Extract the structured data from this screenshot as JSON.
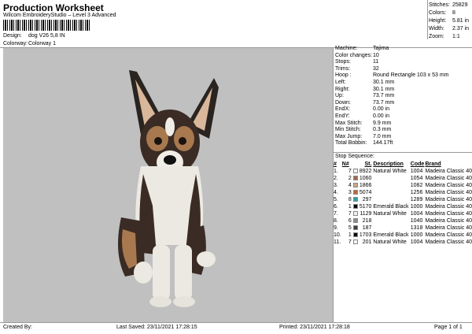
{
  "header": {
    "title": "Production Worksheet",
    "subtitle": "Wilcom EmbroideryStudio – Level 3 Advanced",
    "design_label": "Design:",
    "design_value": "dog V26 5,8 IN",
    "colorway_label": "Colorway:",
    "colorway_value": "Colorway 1"
  },
  "stats": [
    {
      "label": "Stitches:",
      "value": "25829"
    },
    {
      "label": "Colors:",
      "value": "8"
    },
    {
      "label": "Height:",
      "value": "5.81 in"
    },
    {
      "label": "Width:",
      "value": "2.37 in"
    },
    {
      "label": "Zoom:",
      "value": "1:1"
    }
  ],
  "machine": [
    {
      "label": "Machine:",
      "value": "Tajima"
    },
    {
      "label": "Color changes:",
      "value": "10"
    },
    {
      "label": "Stops:",
      "value": "11"
    },
    {
      "label": "Trims:",
      "value": "32"
    },
    {
      "label": "Hoop :",
      "value": "Round Rectangle 103 x 53 mm"
    },
    {
      "label": "Left:",
      "value": "30.1 mm"
    },
    {
      "label": "Right:",
      "value": "30.1 mm"
    },
    {
      "label": "Up:",
      "value": "73.7 mm"
    },
    {
      "label": "Down:",
      "value": "73.7 mm"
    },
    {
      "label": "EndX:",
      "value": "0.00 in"
    },
    {
      "label": "EndY:",
      "value": "0.00 in"
    },
    {
      "label": "Max Stitch:",
      "value": "9.9 mm"
    },
    {
      "label": "Min Stitch:",
      "value": "0.3 mm"
    },
    {
      "label": "Max Jump:",
      "value": "7.0 mm"
    },
    {
      "label": "Total Bobbin:",
      "value": "144.17ft"
    }
  ],
  "sequence": {
    "title": "Stop Sequence:",
    "headers": [
      "#",
      "N#",
      "St.",
      "Description",
      "Code",
      "Brand"
    ],
    "rows": [
      {
        "num": "1.",
        "n": "7",
        "color": "#f4f4f4",
        "st": "8922",
        "desc": "Natural White",
        "code": "1004",
        "brand": "Madeira Classic 40"
      },
      {
        "num": "2.",
        "n": "2",
        "color": "#a06a52",
        "st": "1060",
        "desc": "",
        "code": "1054",
        "brand": "Madeira Classic 40"
      },
      {
        "num": "3.",
        "n": "4",
        "color": "#c9a98f",
        "st": "1866",
        "desc": "",
        "code": "1082",
        "brand": "Madeira Classic 40"
      },
      {
        "num": "4.",
        "n": "3",
        "color": "#b86a3a",
        "st": "5074",
        "desc": "",
        "code": "1256",
        "brand": "Madeira Classic 40"
      },
      {
        "num": "5.",
        "n": "8",
        "color": "#2aa4a0",
        "st": "297",
        "desc": "",
        "code": "1289",
        "brand": "Madeira Classic 40"
      },
      {
        "num": "6.",
        "n": "1",
        "color": "#0a0a0a",
        "st": "5170",
        "desc": "Emerald Black",
        "code": "1000",
        "brand": "Madeira Classic 40"
      },
      {
        "num": "7.",
        "n": "7",
        "color": "#f4f4f4",
        "st": "1129",
        "desc": "Natural White",
        "code": "1004",
        "brand": "Madeira Classic 40"
      },
      {
        "num": "8.",
        "n": "6",
        "color": "#8c8c8c",
        "st": "218",
        "desc": "",
        "code": "1040",
        "brand": "Madeira Classic 40"
      },
      {
        "num": "9.",
        "n": "5",
        "color": "#3c3c3c",
        "st": "187",
        "desc": "",
        "code": "1318",
        "brand": "Madeira Classic 40"
      },
      {
        "num": "10.",
        "n": "1",
        "color": "#0a0a0a",
        "st": "1703",
        "desc": "Emerald Black",
        "code": "1000",
        "brand": "Madeira Classic 40"
      },
      {
        "num": "11.",
        "n": "7",
        "color": "#f4f4f4",
        "st": "201",
        "desc": "Natural White",
        "code": "1004",
        "brand": "Madeira Classic 40"
      }
    ]
  },
  "footer": {
    "created_by": "Created By:",
    "last_saved": "Last Saved: 23/11/2021 17:28:15",
    "printed": "Printed: 23/11/2021 17:28:18",
    "page": "Page 1 of 1"
  }
}
